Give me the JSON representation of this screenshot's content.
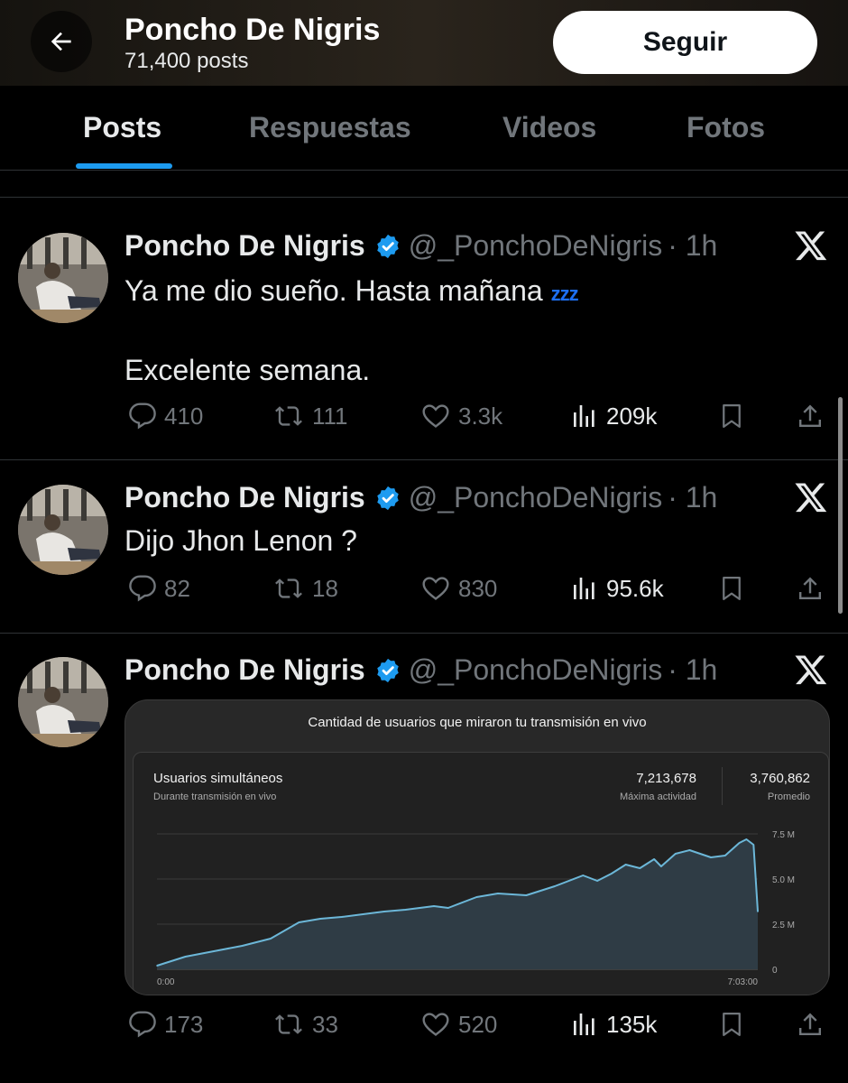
{
  "header": {
    "name": "Poncho De Nigris",
    "posts_count": "71,400 posts",
    "follow_label": "Seguir"
  },
  "tabs": [
    {
      "label": "Posts",
      "active": true
    },
    {
      "label": "Respuestas",
      "active": false
    },
    {
      "label": "Videos",
      "active": false
    },
    {
      "label": "Fotos",
      "active": false
    }
  ],
  "tweets": [
    {
      "name": "Poncho De Nigris",
      "handle": "@_PonchoDeNigris",
      "time": "· 1h",
      "text_line1": "Ya me dio sueño. Hasta mañana",
      "emoji": "zzz",
      "text_line2": "Excelente semana.",
      "replies": "410",
      "reposts": "111",
      "likes": "3.3k",
      "views": "209k"
    },
    {
      "name": "Poncho De Nigris",
      "handle": "@_PonchoDeNigris",
      "time": "· 1h",
      "text_line1": "Dijo Jhon Lenon ?",
      "replies": "82",
      "reposts": "18",
      "likes": "830",
      "views": "95.6k"
    },
    {
      "name": "Poncho De Nigris",
      "handle": "@_PonchoDeNigris",
      "time": "· 1h",
      "replies": "173",
      "reposts": "33",
      "likes": "520",
      "views": "135k"
    }
  ],
  "embed": {
    "card_title": "Cantidad de usuarios que miraron tu transmisión en vivo",
    "metric_title": "Usuarios simultáneos",
    "metric_subtitle": "Durante transmisión en vivo",
    "peak_value": "7,213,678",
    "peak_label": "Máxima actividad",
    "avg_value": "3,760,862",
    "avg_label": "Promedio"
  },
  "chart_data": {
    "type": "area",
    "title": "Usuarios simultáneos",
    "x_tick_labels": [
      "0:00",
      "7:03:00"
    ],
    "y_tick_labels": [
      "0",
      "2.5 M",
      "5.0 M",
      "7.5 M"
    ],
    "ylim": [
      0,
      7.5
    ],
    "y_unit": "M",
    "x_minutes": [
      0,
      20,
      40,
      60,
      80,
      100,
      115,
      130,
      150,
      160,
      175,
      195,
      205,
      225,
      240,
      260,
      280,
      300,
      310,
      320,
      330,
      340,
      350,
      355,
      365,
      375,
      390,
      400,
      410,
      415,
      420,
      423
    ],
    "values": [
      0.2,
      0.7,
      1.0,
      1.3,
      1.7,
      2.6,
      2.8,
      2.9,
      3.1,
      3.2,
      3.3,
      3.5,
      3.4,
      4.0,
      4.2,
      4.1,
      4.6,
      5.2,
      4.9,
      5.3,
      5.8,
      5.6,
      6.1,
      5.7,
      6.4,
      6.6,
      6.2,
      6.3,
      7.0,
      7.2,
      6.9,
      3.2
    ],
    "grid": true,
    "line_color": "#6cb7d8",
    "fill_color": "#2f3c45"
  },
  "colors": {
    "accent": "#1d9bf0",
    "verified": "#1d9bf0",
    "muted": "#71767b"
  }
}
